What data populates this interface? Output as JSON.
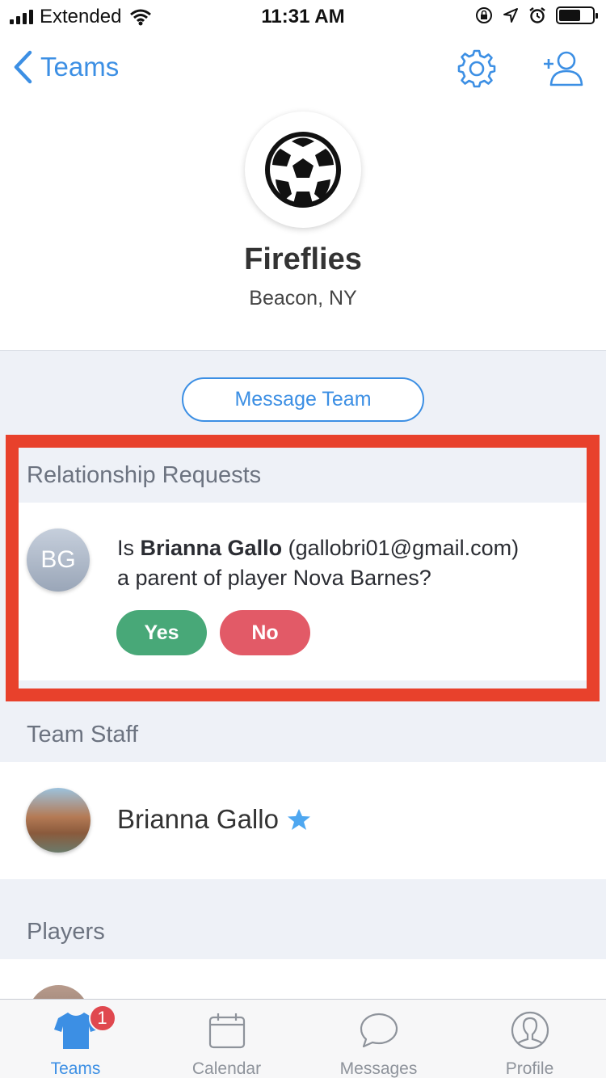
{
  "status_bar": {
    "carrier": "Extended",
    "time": "11:31 AM"
  },
  "nav": {
    "back_label": "Teams"
  },
  "team": {
    "name": "Fireflies",
    "location": "Beacon, NY"
  },
  "message_button": "Message Team",
  "relationship_requests": {
    "header": "Relationship Requests",
    "avatar_initials": "BG",
    "prefix": "Is",
    "person": "Brianna Gallo",
    "email": "(gallobri01@gmail.com)",
    "question_rest": "a parent of player Nova Barnes?",
    "yes_label": "Yes",
    "no_label": "No"
  },
  "team_staff": {
    "header": "Team Staff",
    "members": [
      {
        "name": "Brianna Gallo"
      }
    ]
  },
  "players": {
    "header": "Players"
  },
  "tabs": [
    {
      "label": "Teams",
      "badge": "1"
    },
    {
      "label": "Calendar"
    },
    {
      "label": "Messages"
    },
    {
      "label": "Profile"
    }
  ],
  "colors": {
    "accent": "#3c8fe4",
    "yes": "#48a878",
    "no": "#e25a67",
    "highlight": "#e8412c",
    "badge": "#e0484f"
  }
}
